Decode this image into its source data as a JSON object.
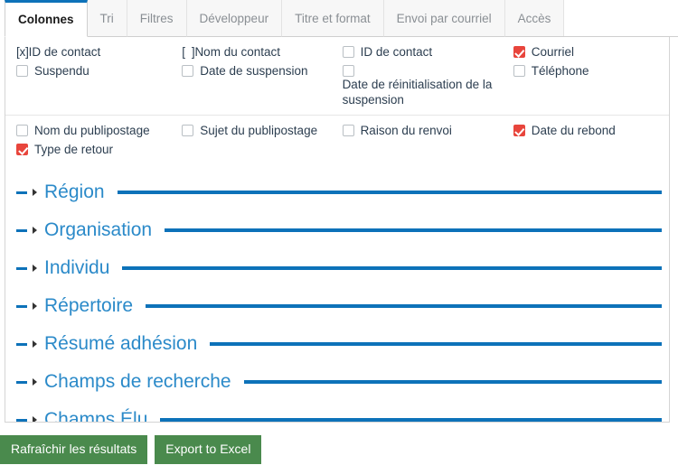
{
  "tabs": [
    {
      "label": "Colonnes",
      "active": true
    },
    {
      "label": "Tri",
      "active": false
    },
    {
      "label": "Filtres",
      "active": false
    },
    {
      "label": "Développeur",
      "active": false
    },
    {
      "label": "Titre et format",
      "active": false
    },
    {
      "label": "Envoi par courriel",
      "active": false
    },
    {
      "label": "Accès",
      "active": false
    }
  ],
  "columns_panel": {
    "groups": [
      {
        "rows": [
          [
            {
              "label": "ID de contact",
              "state": "literal-checked",
              "literal": "[x]"
            },
            {
              "label": "Nom du contact",
              "state": "literal-unchecked",
              "literal": "[  ]"
            },
            {
              "label": "ID de contact",
              "state": "unchecked"
            },
            {
              "label": "Courriel",
              "state": "checked"
            }
          ],
          [
            {
              "label": "Suspendu",
              "state": "unchecked"
            },
            {
              "label": "Date de suspension",
              "state": "unchecked"
            },
            {
              "label": "Date de réinitialisation de la suspension",
              "state": "unchecked"
            },
            {
              "label": "Téléphone",
              "state": "unchecked"
            }
          ]
        ]
      },
      {
        "rows": [
          [
            {
              "label": "Nom du publipostage",
              "state": "unchecked"
            },
            {
              "label": "Sujet du publipostage",
              "state": "unchecked"
            },
            {
              "label": "Raison du renvoi",
              "state": "unchecked"
            },
            {
              "label": "Date du rebond",
              "state": "checked"
            }
          ],
          [
            {
              "label": "Type de retour",
              "state": "checked"
            }
          ]
        ]
      }
    ],
    "sections": [
      {
        "title": "Région"
      },
      {
        "title": "Organisation"
      },
      {
        "title": "Individu"
      },
      {
        "title": "Répertoire"
      },
      {
        "title": "Résumé adhésion"
      },
      {
        "title": "Champs de recherche"
      },
      {
        "title": "Champs Élu"
      }
    ]
  },
  "footer": {
    "refresh_label": "Rafraîchir les résultats",
    "export_label": "Export to Excel"
  },
  "colors": {
    "accent_blue": "#0d72b9",
    "section_title": "#2b8ac9",
    "checkbox_checked": "#e8453c",
    "button_green": "#4a8a4d",
    "text": "#2c3e50"
  }
}
